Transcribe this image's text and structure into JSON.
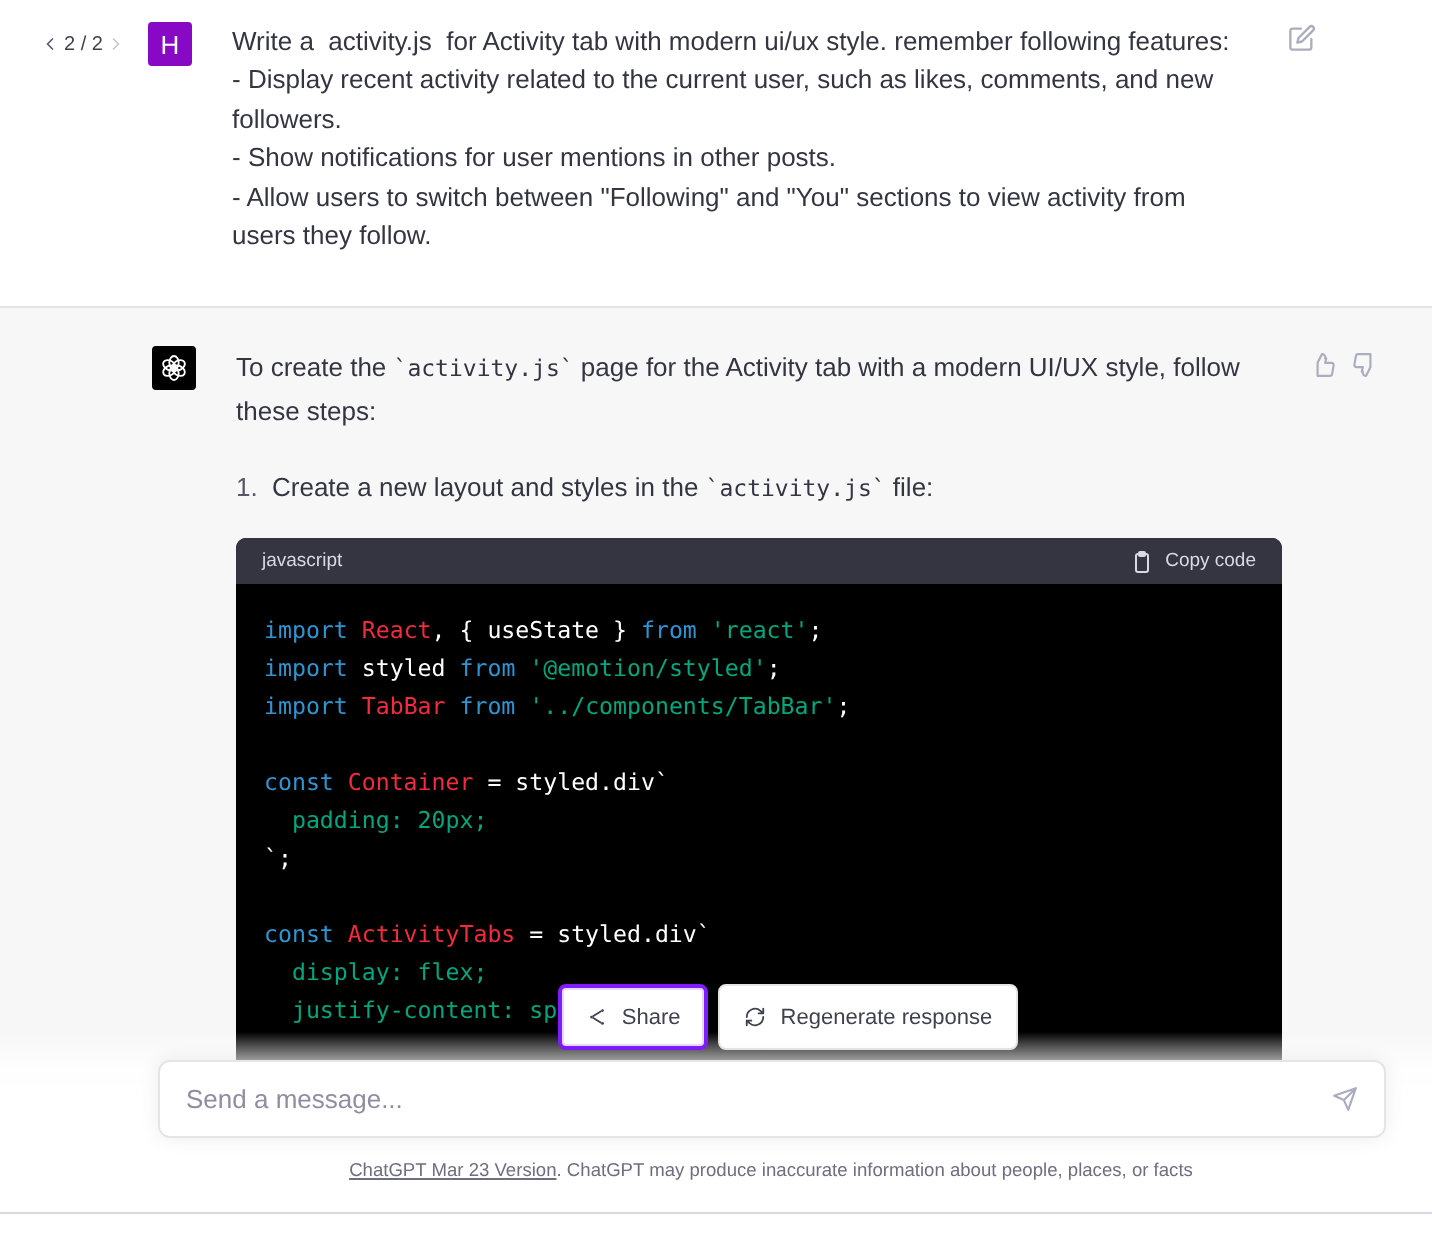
{
  "user_message": {
    "pager": "2 / 2",
    "avatar_letter": "H",
    "lines": [
      "Write a  activity.js  for Activity tab with modern ui/ux style. remember following features:",
      "- Display recent activity related to the current user, such as likes, comments, and new followers.",
      "- Show notifications for user mentions in other posts.",
      "- Allow users to switch between \"Following\" and \"You\" sections to view activity from users they follow."
    ]
  },
  "assistant_message": {
    "intro": [
      {
        "kind": "text",
        "text": "To create the "
      },
      {
        "kind": "code",
        "text": "`activity.js`"
      },
      {
        "kind": "text",
        "text": " page for the Activity tab with a modern UI/UX style, follow these steps:"
      }
    ],
    "steps": [
      {
        "number": "1.",
        "parts": [
          {
            "kind": "text",
            "text": "Create a new layout and styles in the "
          },
          {
            "kind": "code",
            "text": "`activity.js`"
          },
          {
            "kind": "text",
            "text": " file:"
          }
        ]
      }
    ],
    "code_block": {
      "language": "javascript",
      "copy_label": "Copy code",
      "lines": [
        {
          "tokens": [
            {
              "kind": "keyword",
              "text": "import "
            },
            {
              "kind": "name",
              "text": "React"
            },
            {
              "kind": "plain",
              "text": ", { useState } "
            },
            {
              "kind": "keyword",
              "text": "from "
            },
            {
              "kind": "string",
              "text": "'react'"
            },
            {
              "kind": "plain",
              "text": ";"
            }
          ]
        },
        {
          "tokens": [
            {
              "kind": "keyword",
              "text": "import "
            },
            {
              "kind": "plain",
              "text": "styled "
            },
            {
              "kind": "keyword",
              "text": "from "
            },
            {
              "kind": "string",
              "text": "'@emotion/styled'"
            },
            {
              "kind": "plain",
              "text": ";"
            }
          ]
        },
        {
          "tokens": [
            {
              "kind": "keyword",
              "text": "import "
            },
            {
              "kind": "name",
              "text": "TabBar"
            },
            {
              "kind": "keyword",
              "text": " from "
            },
            {
              "kind": "string",
              "text": "'../components/TabBar'"
            },
            {
              "kind": "plain",
              "text": ";"
            }
          ]
        },
        {
          "kind": "blank"
        },
        {
          "tokens": [
            {
              "kind": "keyword",
              "text": "const "
            },
            {
              "kind": "name",
              "text": "Container"
            },
            {
              "kind": "plain",
              "text": " = styled.div`"
            }
          ]
        },
        {
          "tokens": [
            {
              "kind": "string",
              "text": "  padding: 20px;"
            }
          ]
        },
        {
          "tokens": [
            {
              "kind": "plain",
              "text": "`;"
            }
          ]
        },
        {
          "kind": "blank"
        },
        {
          "tokens": [
            {
              "kind": "keyword",
              "text": "const "
            },
            {
              "kind": "name",
              "text": "ActivityTabs"
            },
            {
              "kind": "plain",
              "text": " = styled.div`"
            }
          ]
        },
        {
          "tokens": [
            {
              "kind": "string",
              "text": "  display: flex;"
            }
          ]
        },
        {
          "tokens": [
            {
              "kind": "string",
              "text": "  justify-content: sp"
            }
          ]
        }
      ]
    }
  },
  "actions": [
    {
      "kind": "share",
      "label": "Share",
      "focused": true
    },
    {
      "kind": "regenerate",
      "label": "Regenerate response",
      "focused": false
    }
  ],
  "composer": {
    "placeholder": "Send a message..."
  },
  "footer": {
    "link": "ChatGPT Mar 23 Version",
    "text": ". ChatGPT may produce inaccurate information about people, places, or facts"
  }
}
